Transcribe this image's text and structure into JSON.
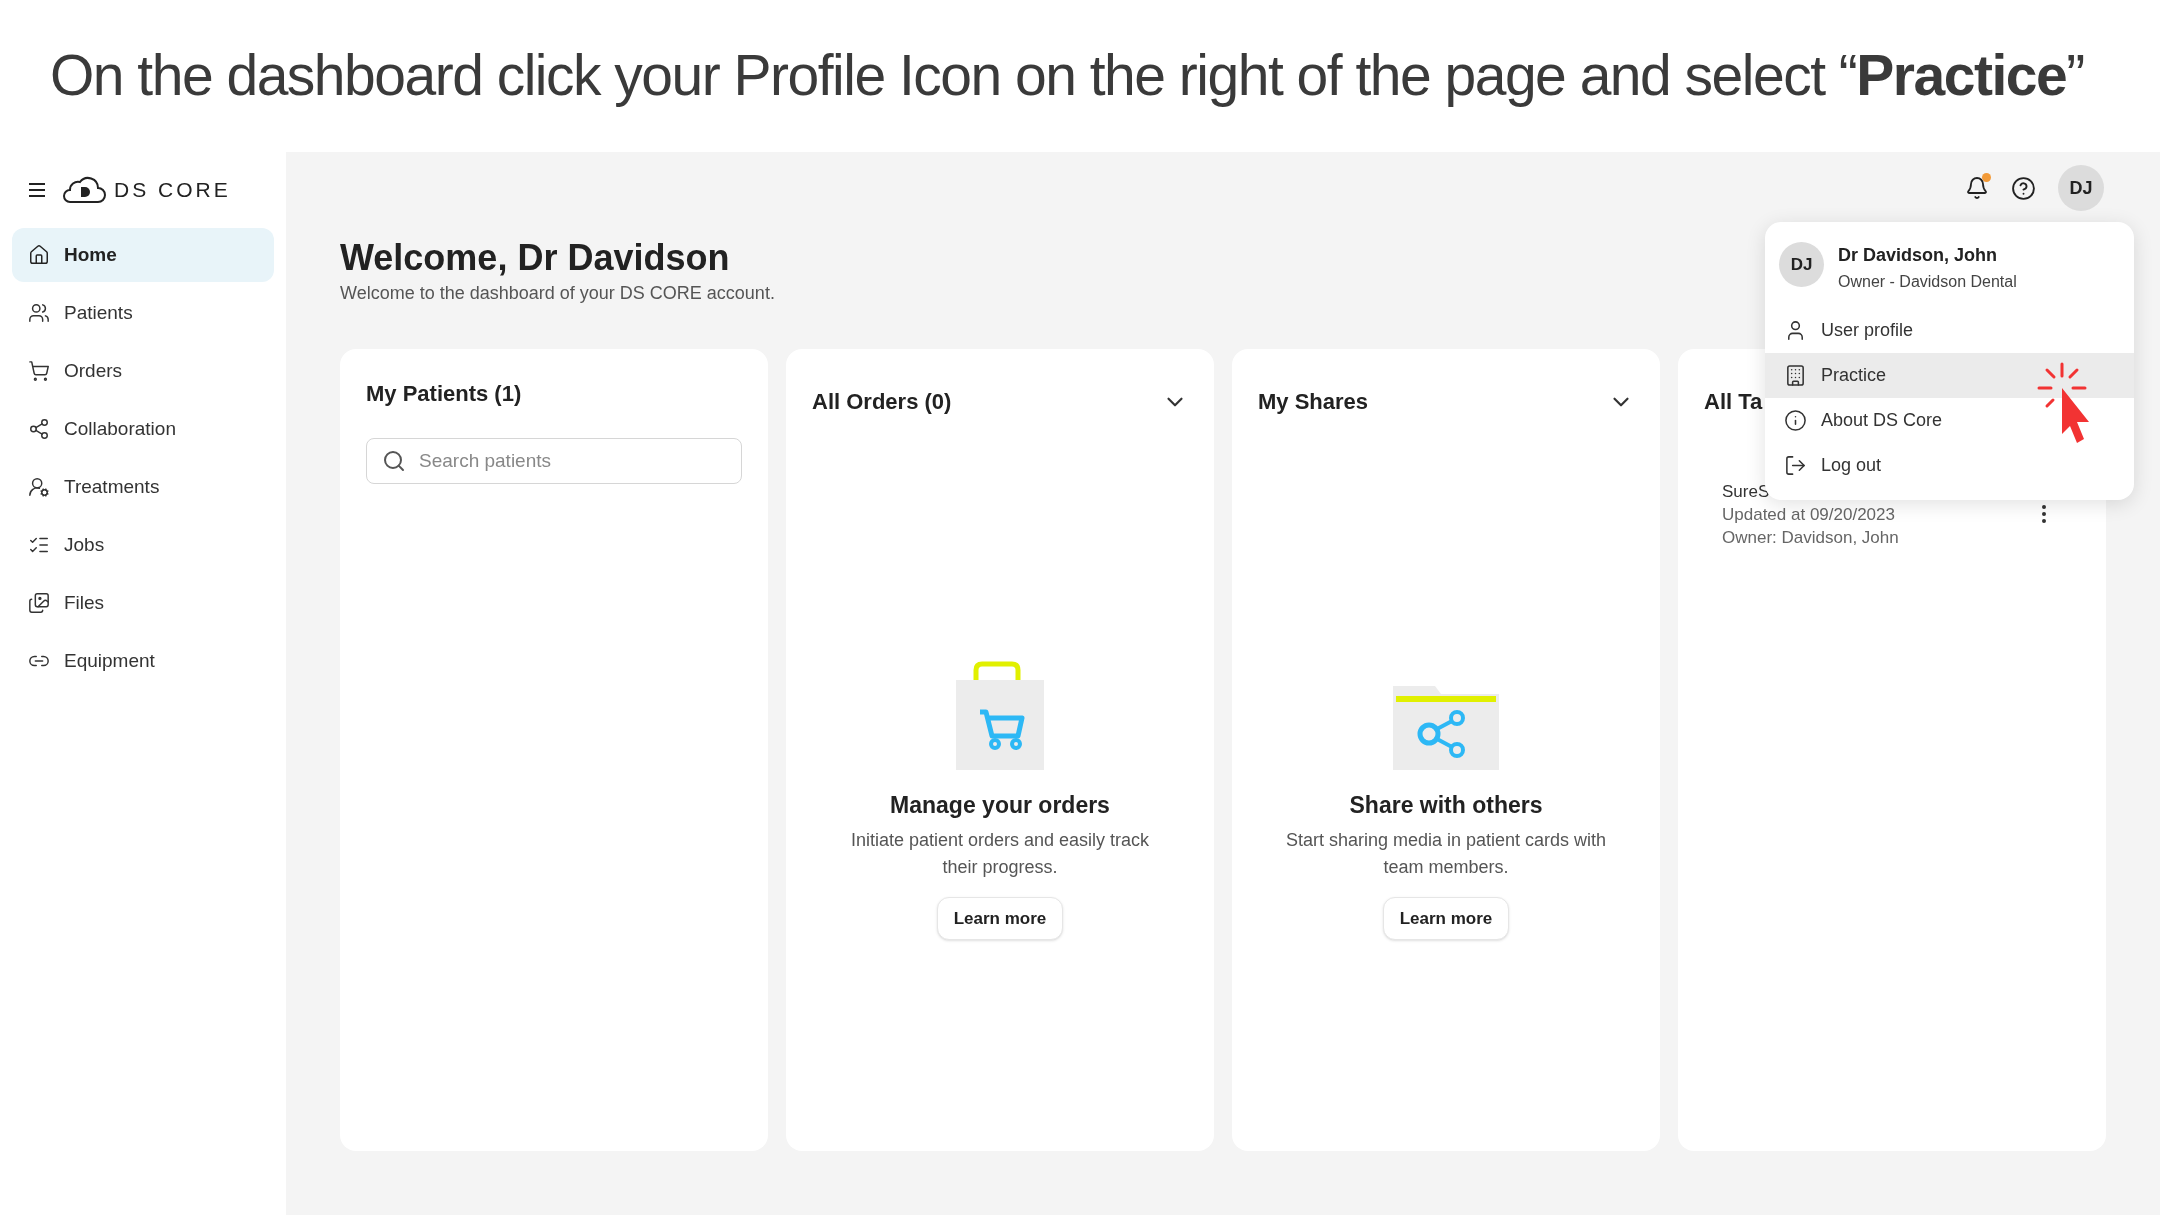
{
  "instruction": "On the dashboard click your Profile Icon on the right of the page and select “**Practice**”",
  "sidebar": {
    "logo": "DS CORE",
    "items": [
      {
        "label": "Home",
        "selected": true
      },
      {
        "label": "Patients",
        "selected": false
      },
      {
        "label": "Orders",
        "selected": false
      },
      {
        "label": "Collaboration",
        "selected": false
      },
      {
        "label": "Treatments",
        "selected": false
      },
      {
        "label": "Jobs",
        "selected": false
      },
      {
        "label": "Files",
        "selected": false
      },
      {
        "label": "Equipment",
        "selected": false
      }
    ]
  },
  "header": {
    "notification": true,
    "avatar": "DJ"
  },
  "welcome": {
    "title": "Welcome, Dr Davidson",
    "subtitle": "Welcome to the dashboard of your DS CORE account."
  },
  "cards": [
    {
      "kind": "patients",
      "title": "My Patients (1)",
      "search_placeholder": "Search patients"
    },
    {
      "kind": "empty",
      "title": "All Orders (0)",
      "heading": "Manage your orders",
      "text": "Initiate patient orders and easily track their progress.",
      "button": "Learn more"
    },
    {
      "kind": "empty",
      "title": "My Shares",
      "heading": "Share with others",
      "text": "Start sharing media in patient cards with team members.",
      "button": "Learn more"
    },
    {
      "kind": "list",
      "title": "All Ta",
      "item": {
        "name": "SureS",
        "updated": "Updated at 09/20/2023",
        "owner": "Owner: Davidson, John"
      }
    }
  ],
  "profile_menu": {
    "avatar": "DJ",
    "name": "Dr Davidson, John",
    "role": "Owner - Davidson Dental",
    "items": [
      {
        "label": "User profile",
        "selected": false
      },
      {
        "label": "Practice",
        "selected": true
      },
      {
        "label": "About DS Core",
        "selected": false
      },
      {
        "label": "Log out",
        "selected": false
      }
    ]
  }
}
